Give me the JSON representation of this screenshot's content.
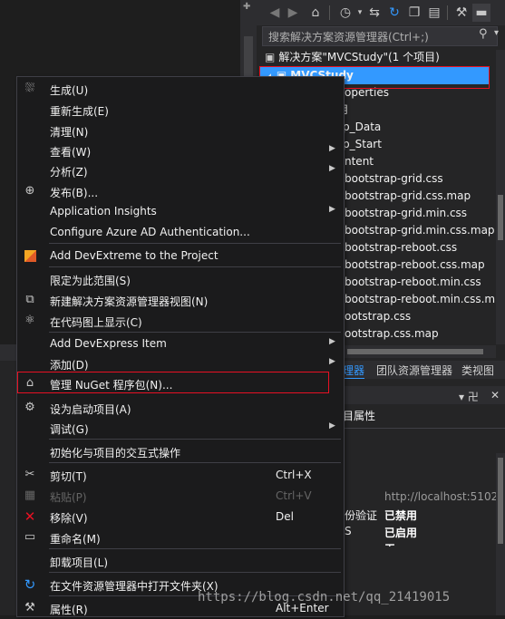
{
  "solution_explorer": {
    "search_placeholder": "搜索解决方案资源管理器(Ctrl+;)",
    "tree": [
      {
        "label": "解决方案\"MVCStudy\"(1 个项目)"
      },
      {
        "label": "MVCStudy",
        "selected": true
      },
      {
        "label": "operties"
      },
      {
        "label": "用"
      },
      {
        "label": "p_Data"
      },
      {
        "label": "p_Start"
      },
      {
        "label": "ntent"
      },
      {
        "label": "bootstrap-grid.css"
      },
      {
        "label": "bootstrap-grid.css.map"
      },
      {
        "label": "bootstrap-grid.min.css"
      },
      {
        "label": "bootstrap-grid.min.css.map"
      },
      {
        "label": "bootstrap-reboot.css"
      },
      {
        "label": "bootstrap-reboot.css.map"
      },
      {
        "label": "bootstrap-reboot.min.css"
      },
      {
        "label": "bootstrap-reboot.min.css.ma"
      },
      {
        "label": "ootstrap.css"
      },
      {
        "label": "ootstrap.css.map"
      }
    ]
  },
  "tabs": {
    "solution_explorer": "理器",
    "team_explorer": "团队资源管理器",
    "class_view": "类视图"
  },
  "properties": {
    "title": "目属性",
    "pin": "▾ 卍",
    "close": "✕",
    "rows": [
      {
        "name": "",
        "value": "http://localhost:5102",
        "color": "#9b9b9b"
      },
      {
        "name": "份验证",
        "value": "已禁用",
        "color": "#ffffff",
        "bold": true
      },
      {
        "name": "S",
        "value": "已启用",
        "color": "#ffffff",
        "bold": true
      },
      {
        "name": "",
        "value": "无",
        "color": "#ffffff",
        "bold": true
      }
    ]
  },
  "context_menu": {
    "items": [
      {
        "label": "生成(U)",
        "icon": "build-icon"
      },
      {
        "label": "重新生成(E)"
      },
      {
        "label": "清理(N)"
      },
      {
        "label": "查看(W)",
        "submenu": true
      },
      {
        "label": "分析(Z)",
        "submenu": true
      },
      {
        "label": "发布(B)...",
        "icon": "globe-icon"
      },
      {
        "label": "Application Insights",
        "submenu": true
      },
      {
        "label": "Configure Azure AD Authentication..."
      },
      {
        "label": "Add DevExtreme to the Project",
        "icon": "devextreme-icon"
      },
      {
        "label": "限定为此范围(S)"
      },
      {
        "label": "新建解决方案资源管理器视图(N)",
        "icon": "new-view-icon"
      },
      {
        "label": "在代码图上显示(C)",
        "icon": "code-map-icon"
      },
      {
        "label": "Add DevExpress Item",
        "submenu": true
      },
      {
        "label": "添加(D)",
        "submenu": true
      },
      {
        "label": "管理 NuGet 程序包(N)...",
        "icon": "nuget-icon",
        "highlighted": true
      },
      {
        "label": "设为启动项目(A)",
        "icon": "gear-icon"
      },
      {
        "label": "调试(G)",
        "submenu": true
      },
      {
        "label": "初始化与项目的交互式操作"
      },
      {
        "label": "剪切(T)",
        "icon": "scissors-icon",
        "shortcut": "Ctrl+X"
      },
      {
        "label": "粘贴(P)",
        "icon": "paste-icon",
        "shortcut": "Ctrl+V",
        "disabled": true
      },
      {
        "label": "移除(V)",
        "icon": "delete-icon",
        "shortcut": "Del",
        "icon_color": "#e81123"
      },
      {
        "label": "重命名(M)",
        "icon": "rename-icon"
      },
      {
        "label": "卸载项目(L)"
      },
      {
        "label": "在文件资源管理器中打开文件夹(X)",
        "icon": "refresh-folder-icon",
        "icon_color": "#3399ff"
      },
      {
        "label": "属性(R)",
        "icon": "wrench-icon",
        "shortcut": "Alt+Enter"
      }
    ]
  },
  "watermark": "https://blog.csdn.net/qq_21419015"
}
